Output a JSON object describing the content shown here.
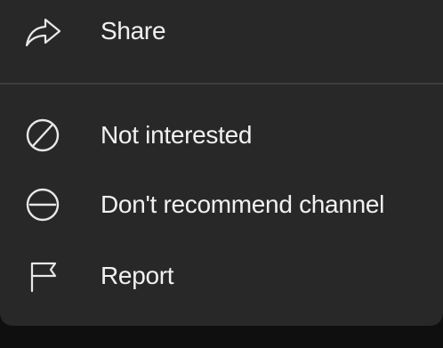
{
  "menu": {
    "items": [
      {
        "label": "Share",
        "icon": "share-arrow-icon"
      },
      {
        "label": "Not interested",
        "icon": "not-interested-icon"
      },
      {
        "label": "Don't recommend channel",
        "icon": "dont-recommend-icon"
      },
      {
        "label": "Report",
        "icon": "flag-icon"
      }
    ]
  },
  "colors": {
    "menu_background": "#282828",
    "page_background": "#0f0f0f",
    "text": "#f1f1f1",
    "icon": "#e8e8e8",
    "divider": "#3d3d3d"
  }
}
